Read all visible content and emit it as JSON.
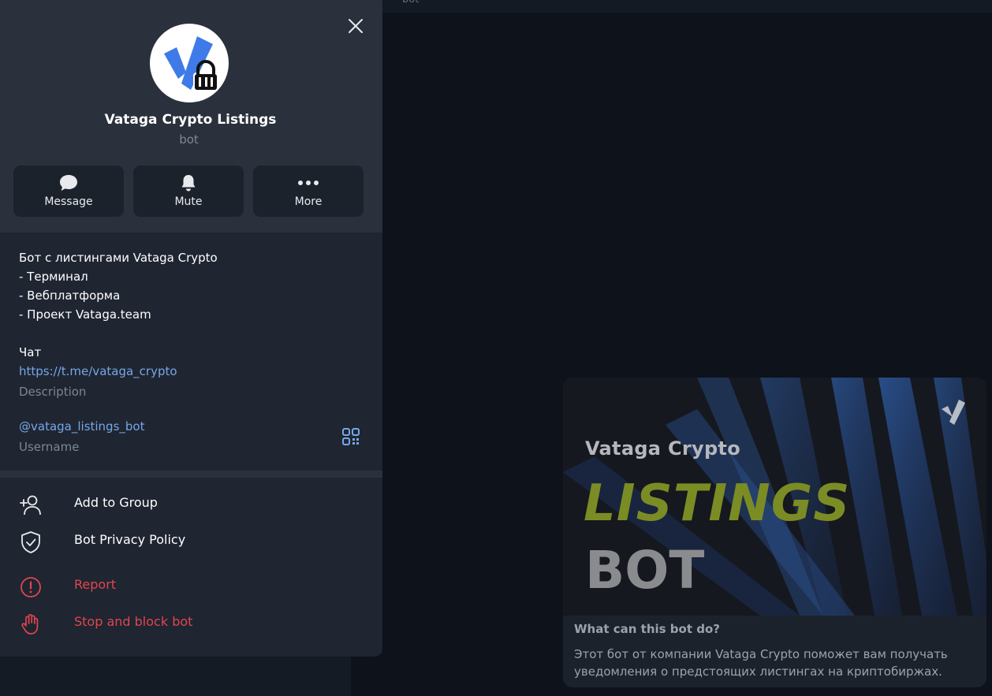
{
  "topbar": {
    "subtitle": "bot"
  },
  "profile": {
    "name": "Vataga Crypto Listings",
    "type": "bot",
    "actions": [
      {
        "label": "Message",
        "icon": "message-bubble-icon"
      },
      {
        "label": "Mute",
        "icon": "bell-icon"
      },
      {
        "label": "More",
        "icon": "more-dots-icon"
      }
    ],
    "description_lines": [
      "Бот с листингами Vataga Crypto",
      "- Терминал",
      "- Вебплатформа",
      "- Проект Vataga.team",
      "",
      "Чат"
    ],
    "chat_link": "https://t.me/vataga_crypto",
    "description_caption": "Description",
    "username": "@vataga_listings_bot",
    "username_caption": "Username",
    "menu": [
      {
        "label": "Add to Group",
        "icon": "add-user-icon",
        "color": "#ffffff"
      },
      {
        "label": "Bot Privacy Policy",
        "icon": "shield-check-icon",
        "color": "#ffffff"
      },
      {
        "label": "Report",
        "icon": "alert-circle-icon",
        "color": "#e0464e"
      },
      {
        "label": "Stop and block bot",
        "icon": "hand-stop-icon",
        "color": "#e0464e"
      }
    ]
  },
  "bot_card": {
    "brand": "Vataga Crypto",
    "headline": "LISTINGS",
    "subheadline": "BOT",
    "question": "What can this bot do?",
    "text": "Этот бот от компании Vataga Crypto поможет вам получать уведомления о предстоящих листингах на криптобиржах."
  },
  "colors": {
    "panel_bg": "#1f2531",
    "link": "#76a7e8",
    "danger": "#e0464e",
    "listings_green": "#7b8c24"
  }
}
